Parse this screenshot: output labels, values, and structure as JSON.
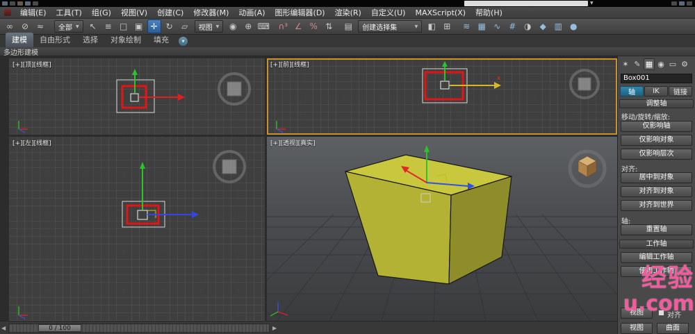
{
  "icons": {
    "dropdown_arrow": "▼",
    "prev": "◀",
    "next": "▶",
    "select_link": "∞",
    "unlink": "⊘",
    "bind_spacewarp": "≈",
    "select_object": "↖",
    "select_by_name": "≡",
    "region_select": "□",
    "window_crossing": "▣",
    "move": "✛",
    "rotate": "↻",
    "scale": "▱",
    "pivot_center": "◉",
    "manipulate": "⊕",
    "keyboard_override": "⌨",
    "snap_3d": "∩³",
    "angle_snap": "∠",
    "percent_snap": "%",
    "spinner_snap": "⇅",
    "named_sets": "▤",
    "mirror": "◧",
    "align": "⊞",
    "layers": "≋",
    "graphite": "▦",
    "curve_editor": "∿",
    "schematic": "#",
    "material": "◑",
    "render_setup": "◆",
    "rendered_frame": "▥",
    "render": "●",
    "cmd_create": "✶",
    "cmd_modify": "✎",
    "cmd_hierarchy": "▦",
    "cmd_motion": "◉",
    "cmd_display": "▭",
    "cmd_utilities": "⚙"
  },
  "menubar": {
    "items": [
      "编辑(E)",
      "工具(T)",
      "组(G)",
      "视图(V)",
      "创建(C)",
      "修改器(M)",
      "动画(A)",
      "图形编辑器(D)",
      "渲染(R)",
      "自定义(U)",
      "MAXScript(X)",
      "帮助(H)"
    ]
  },
  "toolbar": {
    "selection_filter": "全部",
    "coord_system": "视图",
    "named_sets_value": "创建选择集"
  },
  "ribbon": {
    "tabs": [
      "建模",
      "自由形式",
      "选择",
      "对象绘制",
      "填充"
    ],
    "panel_label": "多边形建模"
  },
  "viewports": {
    "top": {
      "label": "[+][顶][线框]"
    },
    "front": {
      "label": "[+][前][线框]"
    },
    "left": {
      "label": "[+][左][线框]"
    },
    "perspective": {
      "label": "[+][透视][真实]"
    }
  },
  "command_panel": {
    "object_name": "Box001",
    "tabs": {
      "pivot": "轴",
      "ik": "IK",
      "link": "链接"
    },
    "adjust_pivot": {
      "title": "调整轴",
      "transform_label": "移动/旋转/缩放:",
      "affect_pivot": "仅影响轴",
      "affect_object": "仅影响对象",
      "affect_hierarchy": "仅影响层次",
      "alignment_label": "对齐:",
      "center_to_object": "居中到对象",
      "align_to_object": "对齐到对象",
      "align_to_world": "对齐到世界",
      "pivot_label": "轴:",
      "reset_pivot": "重置轴"
    },
    "working_pivot": {
      "title": "工作轴",
      "edit_working_pivot": "编辑工作轴",
      "use_working_pivot": "使用工作轴",
      "view_button": "视图",
      "align_checkbox_label": "对齐",
      "place_view": "视图",
      "place_surface": "曲面"
    }
  },
  "timeline": {
    "value": "0 / 100"
  },
  "watermark": {
    "line1": "经验",
    "line2": "u.com"
  },
  "colors": {
    "active_viewport_border": "#c9932b",
    "selection_red": "#e01616",
    "axis_x": "#e02020",
    "axis_y": "#2cc32c",
    "axis_z": "#3355e0",
    "box_top": "#c8c73e",
    "box_front": "#b3b234",
    "box_right": "#8e8d29",
    "watermark_pink": "#f25c9f"
  }
}
